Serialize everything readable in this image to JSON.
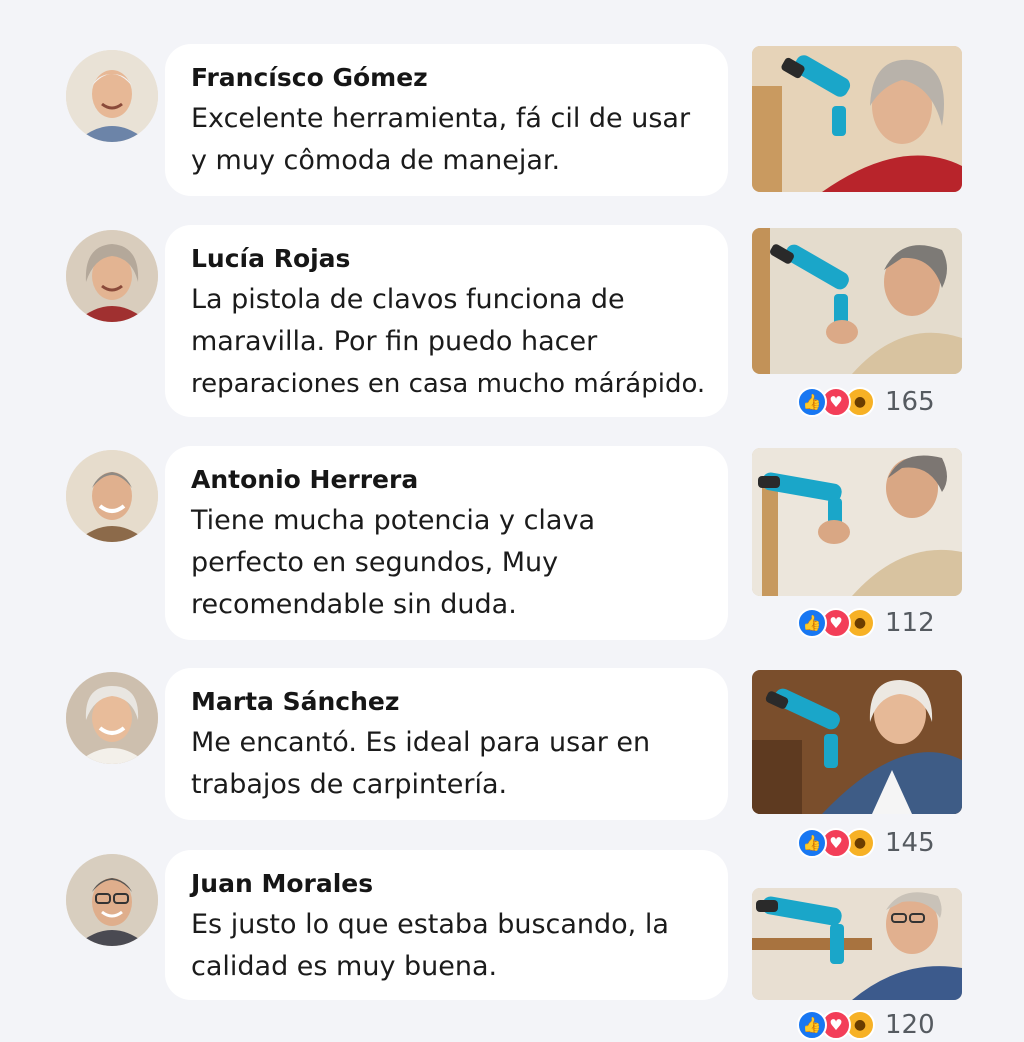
{
  "comments": [
    {
      "author": "Francísco Gómez",
      "lines": [
        "Excelente herramienta, fá cil de usar",
        "y muy cômoda de manejar."
      ],
      "reaction_count": null
    },
    {
      "author": "Lucía Rojas",
      "lines": [
        "La pistola de clavos funciona de",
        "maravilla. Por fin puedo hacer",
        "reparaciones en casa mucho márápido."
      ],
      "reaction_count": "165"
    },
    {
      "author": "Antonio Herrera",
      "lines": [
        "Tiene mucha potencia y clava",
        "perfecto en segundos, Muy",
        "recomendable sin duda."
      ],
      "reaction_count": "112"
    },
    {
      "author": "Marta Sánchez",
      "lines": [
        "Me encantó. Es ideal para usar en",
        "trabajos de carpintería."
      ],
      "reaction_count": "145"
    },
    {
      "author": "Juan Morales",
      "lines": [
        "Es justo lo que estaba buscando, la",
        "calidad es muy buena."
      ],
      "reaction_count": "120"
    }
  ],
  "reaction_icons": [
    "like-icon",
    "love-icon",
    "wow-icon"
  ],
  "colors": {
    "background": "#f3f4f8",
    "bubble": "#ffffff",
    "like": "#1877f2",
    "love": "#f33e58",
    "tool_accent": "#1aa6c9"
  }
}
